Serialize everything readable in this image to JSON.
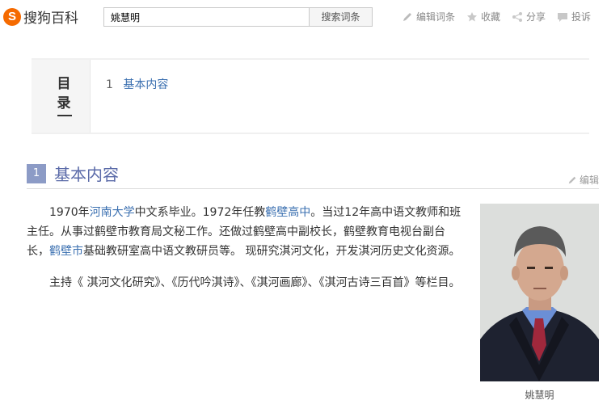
{
  "header": {
    "logo_mark": "S",
    "logo_text": "搜狗百科",
    "search_value": "姚慧明",
    "search_button": "搜索词条",
    "actions": {
      "edit": "编辑词条",
      "favorite": "收藏",
      "share": "分享",
      "complain": "投诉"
    }
  },
  "toc": {
    "title": "目录",
    "items": [
      {
        "num": "1",
        "label": "基本内容"
      }
    ]
  },
  "section": {
    "num": "1",
    "title": "基本内容",
    "edit_label": "编辑"
  },
  "content": {
    "p1": {
      "t1": "1970年",
      "l1": "河南大学",
      "t2": "中文系毕业。1972年任教",
      "l2": "鹤壁高中",
      "t3": "。当过12年高中语文教师和班主任。从事过鹤壁市教育局文秘工作。还做过鹤壁高中副校长，鹤壁教育电视台副台长，",
      "l3": "鹤壁市",
      "t4": "基础教研室高中语文教研员等。 现研究淇河文化，开发淇河历史文化资源。"
    },
    "p2": "主持《 淇河文化研究》、《历代吟淇诗》、《淇河画廊》、《淇河古诗三百首》等栏目。"
  },
  "photo": {
    "caption": "姚慧明"
  },
  "colors": {
    "brand": "#f56a00",
    "link": "#3a6fb0",
    "section_badge": "#8c9bc6",
    "section_title": "#5a6aa8"
  }
}
